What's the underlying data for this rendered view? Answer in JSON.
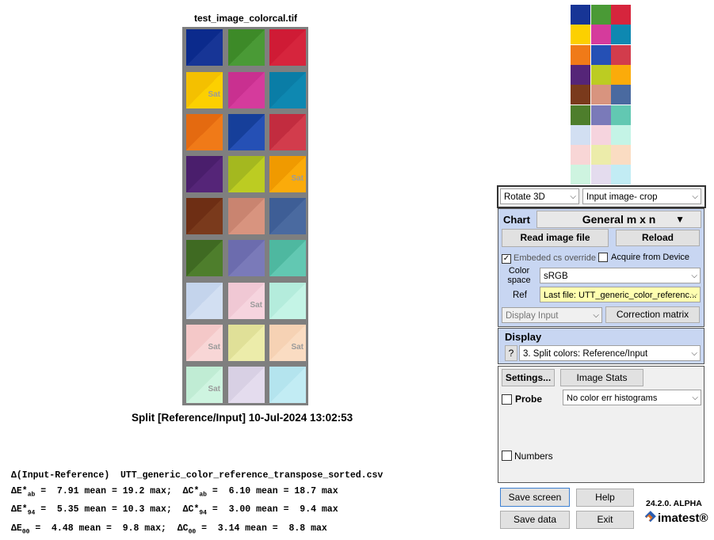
{
  "chart": {
    "title": "test_image_colorcal.tif",
    "caption": "Split [Reference/Input]    10-Jul-2024 13:02:53",
    "sat_label": "Sat"
  },
  "stats": {
    "header": "Δ(Input-Reference)  UTT_generic_color_reference_transpose_sorted.csv",
    "row1": {
      "a": "ΔE*",
      "asub": "ab",
      "b": " =  7.91 mean = 19.2 max;  ΔC*",
      "bsub": "ab",
      "c": " =  6.10 mean = 18.7 max"
    },
    "row2": {
      "a": "ΔE*",
      "asub": "94",
      "b": " =  5.35 mean = 10.3 max;  ΔC*",
      "bsub": "94",
      "c": " =  3.00 mean =  9.4 max"
    },
    "row3": {
      "a": "ΔE",
      "asub": "00",
      "b": " =  4.48 mean =  9.8 max;  ΔC",
      "bsub": "00",
      "c": " =  3.14 mean =  8.8 max"
    }
  },
  "controls": {
    "rotate_select": "Rotate 3D",
    "view_select": "Input image- crop",
    "chart_label": "Chart",
    "chart_type": "General m x n",
    "read_image": "Read image file",
    "reload": "Reload",
    "embeded_cs": "Embeded cs override",
    "acquire": "Acquire from Device",
    "color_space_label": "Color space",
    "color_space": "sRGB",
    "ref_label": "Ref",
    "ref_value": "Last file: UTT_generic_color_referenc...",
    "display_input": "Display Input",
    "correction_matrix": "Correction matrix",
    "display_label": "Display",
    "help_q": "?",
    "display_mode": "3.  Split colors: Reference/Input",
    "settings": "Settings...",
    "image_stats": "Image Stats",
    "probe": "Probe",
    "histogram": "No color err histograms",
    "numbers": "Numbers",
    "save_screen": "Save screen",
    "help": "Help",
    "save_data": "Save data",
    "exit": "Exit",
    "version": "24.2.0. ALPHA",
    "brand": "imatest®"
  },
  "patches": [
    {
      "ref": "#0b2a8c",
      "inp": "#173596",
      "sat": false
    },
    {
      "ref": "#3d8a28",
      "inp": "#4a9a36",
      "sat": false
    },
    {
      "ref": "#cf1b35",
      "inp": "#d6253d",
      "sat": false
    },
    {
      "ref": "#f4c000",
      "inp": "#fcd000",
      "sat": true
    },
    {
      "ref": "#c93090",
      "inp": "#d53b9c",
      "sat": false
    },
    {
      "ref": "#0a7da6",
      "inp": "#0e88b1",
      "sat": false
    },
    {
      "ref": "#e46a10",
      "inp": "#f07a18",
      "sat": false
    },
    {
      "ref": "#163f9a",
      "inp": "#2550b5",
      "sat": false
    },
    {
      "ref": "#c22c3f",
      "inp": "#d23c4c",
      "sat": false
    },
    {
      "ref": "#4a1e6c",
      "inp": "#552578",
      "sat": false
    },
    {
      "ref": "#a4b81f",
      "inp": "#bccc22",
      "sat": false
    },
    {
      "ref": "#f09a00",
      "inp": "#fbab0a",
      "sat": true
    },
    {
      "ref": "#6e2e14",
      "inp": "#7a3a1c",
      "sat": false
    },
    {
      "ref": "#c98470",
      "inp": "#d8947f",
      "sat": false
    },
    {
      "ref": "#3e5e96",
      "inp": "#4a6aa0",
      "sat": false
    },
    {
      "ref": "#3f6a22",
      "inp": "#4e7e2c",
      "sat": false
    },
    {
      "ref": "#6c6cae",
      "inp": "#7a7ab9",
      "sat": false
    },
    {
      "ref": "#4eb8a0",
      "inp": "#62c8b2",
      "sat": false
    },
    {
      "ref": "#c4d4ec",
      "inp": "#d2dff2",
      "sat": false
    },
    {
      "ref": "#f0c8d4",
      "inp": "#f6d4de",
      "sat": true
    },
    {
      "ref": "#b4ecdc",
      "inp": "#c4f4e6",
      "sat": false
    },
    {
      "ref": "#f4c8c8",
      "inp": "#f8d6d6",
      "sat": true
    },
    {
      "ref": "#e0e098",
      "inp": "#ecec aa",
      "sat": false
    },
    {
      "ref": "#f6d2b4",
      "inp": "#fadcc2",
      "sat": true
    },
    {
      "ref": "#c0ecd4",
      "inp": "#cef4e0",
      "sat": true
    },
    {
      "ref": "#d8d0e4",
      "inp": "#e4dcee",
      "sat": false
    },
    {
      "ref": "#b4e4ee",
      "inp": "#c2ecf4",
      "sat": false
    }
  ]
}
